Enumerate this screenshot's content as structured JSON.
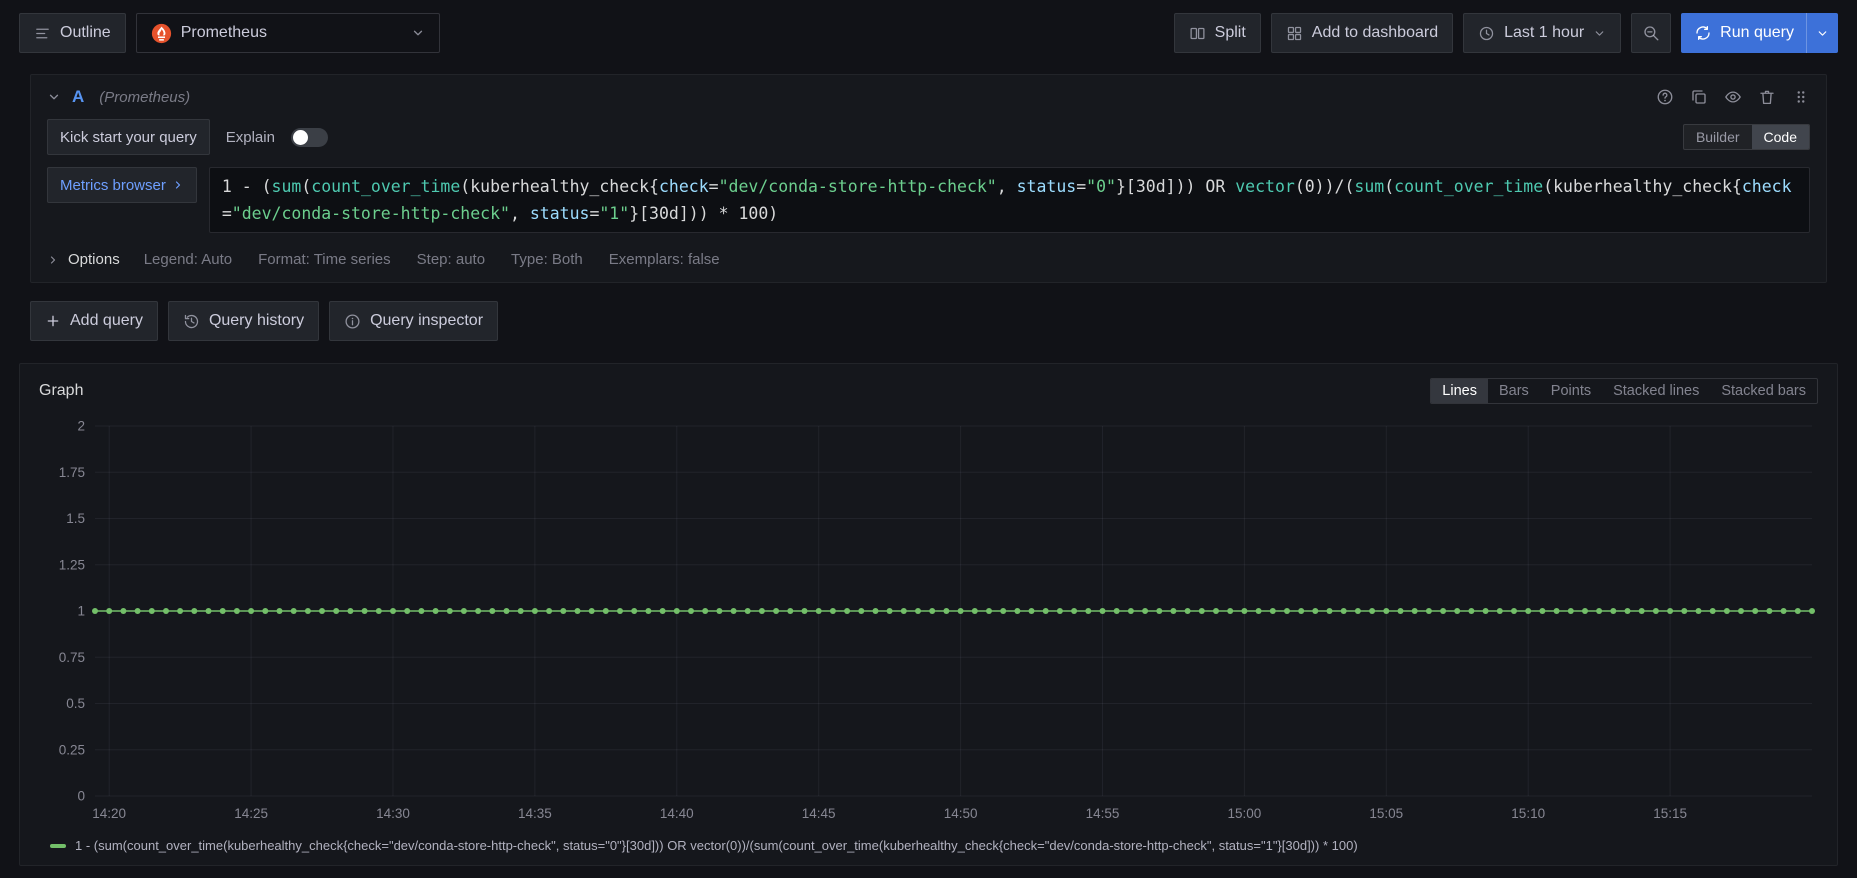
{
  "colors": {
    "accent_blue": "#3d71d9",
    "link_blue": "#6e9fff",
    "ref_id_blue": "#5794f2",
    "prometheus_orange": "#e6522c",
    "series_green": "#73bf69"
  },
  "syntax_colors": {
    "function": "#4ec9b0",
    "label": "#9cdcfe",
    "string": "#6ccf8e",
    "default": "#d8d9da"
  },
  "topbar": {
    "outline_label": "Outline",
    "datasource": "Prometheus",
    "split_label": "Split",
    "add_to_dashboard_label": "Add to dashboard",
    "time_range_label": "Last 1 hour",
    "run_query_label": "Run query"
  },
  "query_editor": {
    "ref_id": "A",
    "datasource_hint": "(Prometheus)",
    "kick_start_label": "Kick start your query",
    "explain_label": "Explain",
    "explain_enabled": false,
    "mode_options": [
      "Builder",
      "Code"
    ],
    "active_mode": "Code",
    "metrics_browser_label": "Metrics browser",
    "query": "1 - (sum(count_over_time(kuberhealthy_check{check=\"dev/conda-store-http-check\", status=\"0\"}[30d])) OR vector(0))/(sum(count_over_time(kuberhealthy_check{check=\"dev/conda-store-http-check\", status=\"1\"}[30d])) * 100)",
    "options_label": "Options",
    "options_summary": [
      "Legend: Auto",
      "Format: Time series",
      "Step: auto",
      "Type: Both",
      "Exemplars: false"
    ]
  },
  "query_actions": {
    "add_query_label": "Add query",
    "query_history_label": "Query history",
    "query_inspector_label": "Query inspector"
  },
  "graph": {
    "title": "Graph",
    "style_options": [
      "Lines",
      "Bars",
      "Points",
      "Stacked lines",
      "Stacked bars"
    ],
    "active_style": "Lines"
  },
  "chart_data": {
    "type": "line",
    "title": "Graph",
    "x_ticks": [
      "14:20",
      "14:25",
      "14:30",
      "14:35",
      "14:40",
      "14:45",
      "14:50",
      "14:55",
      "15:00",
      "15:05",
      "15:10",
      "15:15"
    ],
    "x_tick_offsets_s": [
      30,
      330,
      630,
      930,
      1230,
      1530,
      1830,
      2130,
      2430,
      2730,
      3030,
      3330
    ],
    "x_domain_seconds": 3630,
    "y_ticks": [
      "2",
      "1.75",
      "1.5",
      "1.25",
      "1",
      "0.75",
      "0.5",
      "0.25",
      "0"
    ],
    "ylim": [
      0,
      2
    ],
    "grid": true,
    "legend_position": "bottom",
    "series": [
      {
        "name": "1 - (sum(count_over_time(kuberhealthy_check{check=\"dev/conda-store-http-check\", status=\"0\"}[30d])) OR vector(0))/(sum(count_over_time(kuberhealthy_check{check=\"dev/conda-store-http-check\", status=\"1\"}[30d])) * 100)",
        "color": "#73bf69",
        "flat_value": 1,
        "point_interval_s": 30,
        "style": "line_with_points"
      }
    ]
  }
}
